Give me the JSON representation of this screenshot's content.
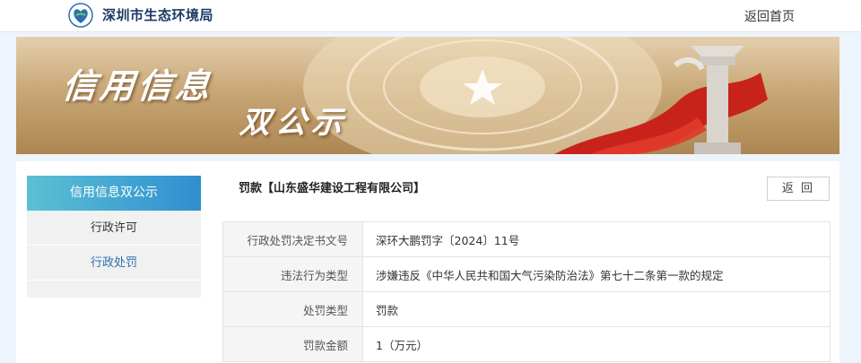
{
  "header": {
    "site_name": "深圳市生态环境局",
    "home_link": "返回首页"
  },
  "banner": {
    "title": "信用信息",
    "subtitle": "双公示"
  },
  "sidebar": {
    "header": "信用信息双公示",
    "items": [
      {
        "label": "行政许可"
      },
      {
        "label": "行政处罚"
      }
    ]
  },
  "record": {
    "title": "罚款【山东盛华建设工程有限公司】",
    "back_label": "返 回",
    "rows": [
      {
        "key": "行政处罚决定书文号",
        "value": "深环大鹏罚字〔2024〕11号"
      },
      {
        "key": "违法行为类型",
        "value": "涉嫌违反《中华人民共和国大气污染防治法》第七十二条第一款的规定"
      },
      {
        "key": "处罚类型",
        "value": "罚款"
      },
      {
        "key": "罚款金额",
        "value": "1（万元）"
      }
    ]
  },
  "colors": {
    "sidebar_gradient_start": "#5cc0d4",
    "sidebar_gradient_end": "#2f8fd0",
    "active_item": "#2b6fb0",
    "page_background": "#eef4fb"
  }
}
